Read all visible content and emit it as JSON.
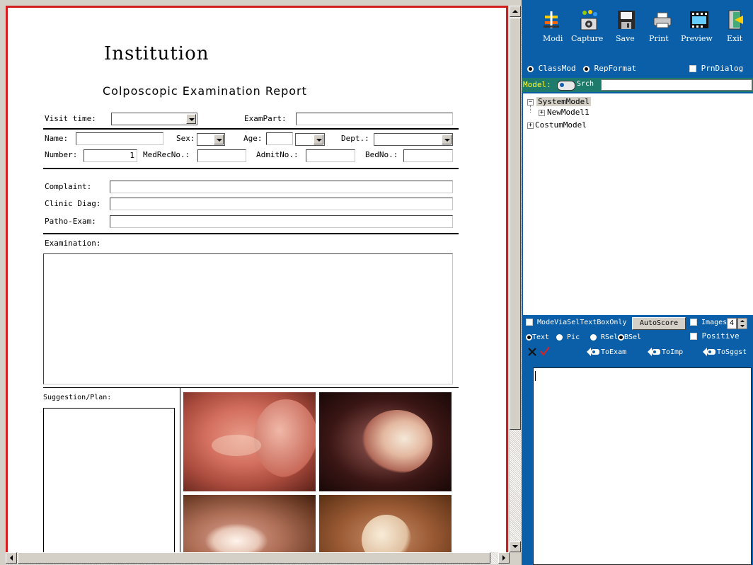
{
  "report": {
    "institution": "Institution",
    "title": "Colposcopic Examination Report",
    "labels": {
      "visit_time": "Visit time:",
      "exam_part": "ExamPart:",
      "name": "Name:",
      "sex": "Sex:",
      "age": "Age:",
      "dept": "Dept.:",
      "number": "Number:",
      "medrec": "MedRecNo.:",
      "admit": "AdmitNo.:",
      "bed": "BedNo.:",
      "complaint": "Complaint:",
      "clinic_diag": "Clinic Diag:",
      "patho_exam": "Patho-Exam:",
      "examination": "Examination:",
      "suggestion": "Suggestion/Plan:"
    },
    "values": {
      "number": "1"
    }
  },
  "toolbar": {
    "items": [
      {
        "label": "Modi",
        "icon": "modify-icon"
      },
      {
        "label": "Capture",
        "icon": "capture-icon"
      },
      {
        "label": "Save",
        "icon": "save-icon"
      },
      {
        "label": "Print",
        "icon": "print-icon"
      },
      {
        "label": "Preview",
        "icon": "preview-icon"
      },
      {
        "label": "Exit",
        "icon": "exit-icon"
      }
    ]
  },
  "mode": {
    "classmod": "ClassMod",
    "repformat": "RepFormat",
    "prndialog": "PrnDialog"
  },
  "model_bar": {
    "model_label": "Model:",
    "srch_label": "Srch"
  },
  "tree": {
    "system": "SystemModel",
    "newmodel": "NewModel1",
    "costum": "CostumModel"
  },
  "controls": {
    "modevia": "ModeViaSelTextBoxOnly",
    "autoscore": "AutoScore",
    "images": "Images",
    "images_value": "4",
    "positive": "Positive",
    "text": "Text",
    "pic": "Pic",
    "rsel": "RSel",
    "bsel": "BSel",
    "toexam": "ToExam",
    "toimp": "ToImp",
    "tosggst": "ToSggst"
  },
  "colors": {
    "panel_blue": "#0a5fa8",
    "report_border_red": "#d21e1e"
  }
}
